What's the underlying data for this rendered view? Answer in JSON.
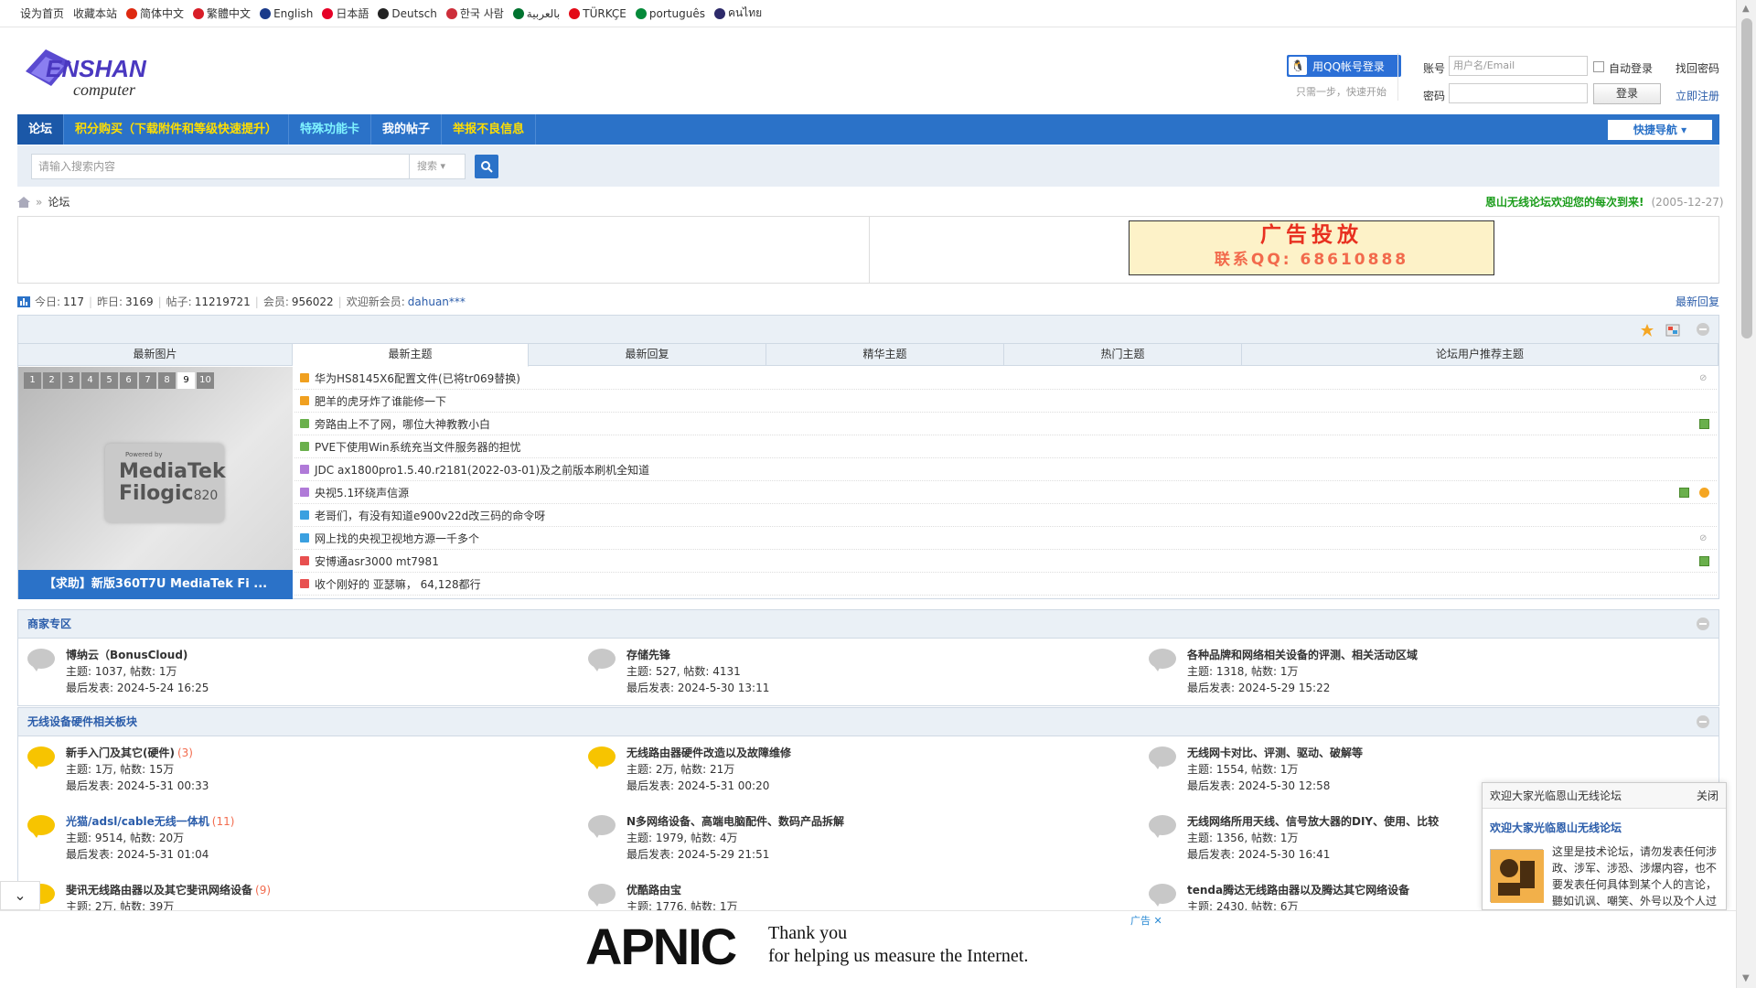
{
  "topbar": {
    "links": [
      "设为首页",
      "收藏本站"
    ],
    "languages": [
      {
        "label": "简体中文",
        "color": "#de2910"
      },
      {
        "label": "繁體中文",
        "color": "#d81e28"
      },
      {
        "label": "English",
        "color": "#1a3a8a"
      },
      {
        "label": "日本語",
        "color": "#e60026"
      },
      {
        "label": "Deutsch",
        "color": "#222222"
      },
      {
        "label": "한국 사람",
        "color": "#cd2e3a"
      },
      {
        "label": "بالعربية",
        "color": "#00732f"
      },
      {
        "label": "TÜRKÇE",
        "color": "#e30a17"
      },
      {
        "label": "português",
        "color": "#058a3a"
      },
      {
        "label": "คนไทย",
        "color": "#2d2a6a"
      }
    ],
    "arrows": "‹‹"
  },
  "logo": {
    "line1": "ENSHAN",
    "line2": "computer"
  },
  "login": {
    "qq_button": "用QQ帐号登录",
    "qq_sub": "只需一步，快速开始",
    "account_label": "账号",
    "account_placeholder": "用户名/Email",
    "auto_login": "自动登录",
    "find_password": "找回密码",
    "password_label": "密码",
    "login_button": "登录",
    "register": "立即注册"
  },
  "nav": {
    "items": [
      {
        "label": "论坛",
        "style": "active"
      },
      {
        "label": "积分购买（下载附件和等级快速提升）",
        "style": "yellow"
      },
      {
        "label": "特殊功能卡",
        "style": "cyan"
      },
      {
        "label": "我的帖子",
        "style": "white"
      },
      {
        "label": "举报不良信息",
        "style": "yellow"
      }
    ],
    "quick_nav": "快捷导航"
  },
  "search": {
    "placeholder": "请输入搜索内容",
    "select": "搜索"
  },
  "breadcrumb": {
    "sep": "»",
    "current": "论坛"
  },
  "welcome": {
    "text": "恩山无线论坛欢迎您的每次到来!",
    "date": "(2005-12-27)"
  },
  "ad": {
    "line1": "广告投放",
    "line2": "联系QQ: 68610888"
  },
  "stats": {
    "today_label": "今日:",
    "today": "117",
    "yesterday_label": "昨日:",
    "yesterday": "3169",
    "posts_label": "帖子:",
    "posts": "11219721",
    "members_label": "会员:",
    "members": "956022",
    "new_member_label": "欢迎新会员:",
    "new_member": "dahuan***",
    "latest_reply": "最新回复"
  },
  "tabs": [
    "最新图片",
    "最新主题",
    "最新回复",
    "精华主题",
    "热门主题",
    "论坛用户推荐主题"
  ],
  "slider": {
    "numbers": [
      "1",
      "2",
      "3",
      "4",
      "5",
      "6",
      "7",
      "8",
      "9",
      "10"
    ],
    "active": "9",
    "powered": "Powered by",
    "chip1": "MediaTek",
    "chip2": "Filogic",
    "chip3": "820",
    "caption": "【求助】新版360T7U MediaTek Fi ..."
  },
  "threads": [
    {
      "title": "华为HS8145X6配置文件(已将tr069替换)",
      "icon": "#f0a020",
      "right": "clip"
    },
    {
      "title": "肥羊的虎牙炸了谁能修一下",
      "icon": "#f0a020",
      "right": ""
    },
    {
      "title": "旁路由上不了网，哪位大神教教小白",
      "icon": "#6ab04c",
      "right": "img"
    },
    {
      "title": "PVE下使用Win系统充当文件服务器的担忧",
      "icon": "#6ab04c",
      "right": ""
    },
    {
      "title": "JDC ax1800pro1.5.40.r2181(2022-03-01)及之前版本刷机全知道",
      "icon": "#b07ad8",
      "right": ""
    },
    {
      "title": "央视5.1环绕声信源",
      "icon": "#b07ad8",
      "right": "img2"
    },
    {
      "title": "老哥们，有没有知道e900v22d改三码的命令呀",
      "icon": "#3aa0e0",
      "right": ""
    },
    {
      "title": "网上找的央视卫视地方源一千多个",
      "icon": "#3aa0e0",
      "right": "clip"
    },
    {
      "title": "安博通asr3000 mt7981",
      "icon": "#e85050",
      "right": "img"
    },
    {
      "title": "收个刚好的 亚瑟嘛， 64,128都行",
      "icon": "#e85050",
      "right": ""
    }
  ],
  "sections": [
    {
      "title": "商家专区",
      "forums": [
        {
          "name": "博纳云（BonusCloud)",
          "count": "",
          "topics": "主题: 1037, 帖数: 1万",
          "last": "最后发表: 2024-5-24 16:25",
          "active": false
        },
        {
          "name": "存储先锋",
          "count": "",
          "topics": "主题: 527, 帖数: 4131",
          "last": "最后发表: 2024-5-30 13:11",
          "active": false
        },
        {
          "name": "各种品牌和网络相关设备的评测、相关活动区域",
          "count": "",
          "topics": "主题: 1318, 帖数: 1万",
          "last": "最后发表: 2024-5-29 15:22",
          "active": false
        }
      ]
    },
    {
      "title": "无线设备硬件相关板块",
      "forums": [
        {
          "name": "新手入门及其它(硬件)",
          "count": "(3)",
          "topics": "主题: 1万, 帖数: 15万",
          "last": "最后发表: 2024-5-31 00:33",
          "active": true
        },
        {
          "name": "无线路由器硬件改造以及故障维修",
          "count": "",
          "topics": "主题: 2万, 帖数: 21万",
          "last": "最后发表: 2024-5-31 00:20",
          "active": true
        },
        {
          "name": "无线网卡对比、评测、驱动、破解等",
          "count": "",
          "topics": "主题: 1554, 帖数: 1万",
          "last": "最后发表: 2024-5-30 12:58",
          "active": false
        },
        {
          "name": "光猫/adsl/cable无线一体机",
          "count": "(11)",
          "topics": "主题: 9514, 帖数: 20万",
          "last": "最后发表: 2024-5-31 01:04",
          "active": true
        },
        {
          "name": "N多网络设备、高端电脑配件、数码产品拆解",
          "count": "",
          "topics": "主题: 1979, 帖数: 4万",
          "last": "最后发表: 2024-5-29 21:51",
          "active": false
        },
        {
          "name": "无线网络所用天线、信号放大器的DIY、使用、比较",
          "count": "",
          "topics": "主题: 1356, 帖数: 1万",
          "last": "最后发表: 2024-5-30 16:41",
          "active": false
        },
        {
          "name": "斐讯无线路由器以及其它斐讯网络设备",
          "count": "(9)",
          "topics": "主题: 2万, 帖数: 39万",
          "last": "",
          "active": true
        },
        {
          "name": "优酷路由宝",
          "count": "",
          "topics": "主题: 1776, 帖数: 1万",
          "last": "",
          "active": false
        },
        {
          "name": "tenda腾达无线路由器以及腾达其它网络设备",
          "count": "",
          "topics": "主题: 2430, 帖数: 6万",
          "last": "",
          "active": false
        }
      ]
    }
  ],
  "popup": {
    "header": "欢迎大家光临恩山无线论坛",
    "close": "关闭",
    "title": "欢迎大家光临恩山无线论坛",
    "text": "这里是技术论坛，请勿发表任何涉政、涉军、涉恐、涉爆内容，也不要发表任何具体到某个人的言论，聽如讥讽、嘲笑、外号以及个人过"
  },
  "bottom_ad": {
    "logo": "APNIC",
    "line1": "Thank you",
    "line2": "for helping us measure the Internet.",
    "close": "广告 ✕"
  }
}
